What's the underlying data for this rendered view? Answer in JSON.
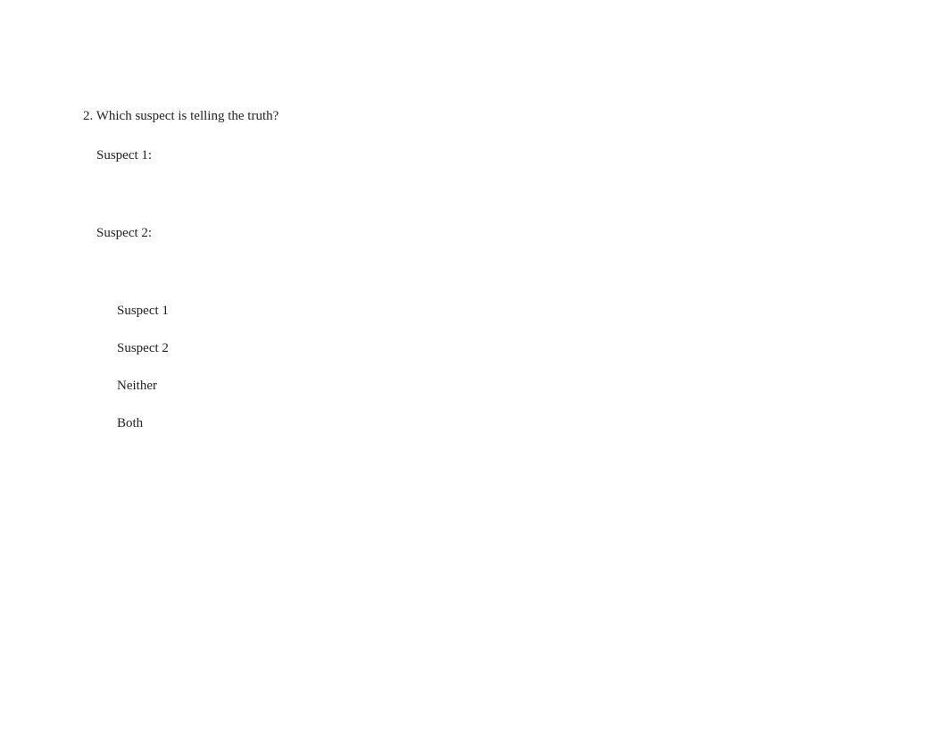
{
  "question": {
    "number": "2.",
    "text": "Which suspect is telling the truth?",
    "labels": {
      "suspect1": "Suspect 1:",
      "suspect2": "Suspect 2:"
    },
    "options": [
      "Suspect 1",
      "Suspect 2",
      "Neither",
      "Both"
    ]
  }
}
